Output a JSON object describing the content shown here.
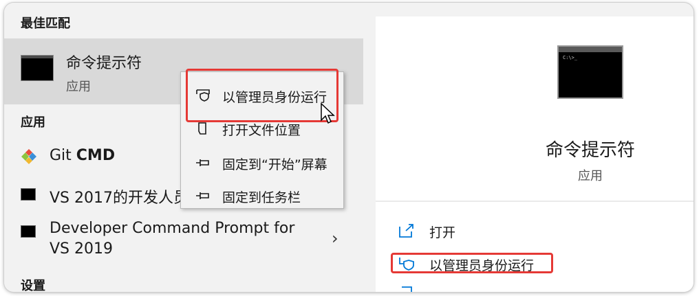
{
  "left": {
    "best_match_header": "最佳匹配",
    "best_match": {
      "title": "命令提示符",
      "subtitle": "应用"
    },
    "apps_header": "应用",
    "apps": [
      {
        "name_prefix": "Git ",
        "name_bold": "CMD",
        "icon": "git-icon"
      },
      {
        "name": "VS 2017的开发人员",
        "icon": "console-icon"
      },
      {
        "name_line1": "Developer Command Prompt for",
        "name_line2": "VS 2019",
        "icon": "console-icon"
      }
    ],
    "settings_header": "设置"
  },
  "context_menu": {
    "items": [
      {
        "label": "以管理员身份运行",
        "icon": "shield-icon"
      },
      {
        "label": "打开文件位置",
        "icon": "folder-icon"
      },
      {
        "label": "固定到“开始”屏幕",
        "icon": "pin-icon"
      },
      {
        "label": "固定到任务栏",
        "icon": "pin-icon"
      }
    ]
  },
  "right": {
    "title": "命令提示符",
    "subtitle": "应用",
    "actions": [
      {
        "label": "打开",
        "icon": "open-icon"
      },
      {
        "label": "以管理员身份运行",
        "icon": "shield-icon"
      }
    ]
  },
  "colors": {
    "highlight": "#e53935",
    "accent": "#0078d7"
  }
}
